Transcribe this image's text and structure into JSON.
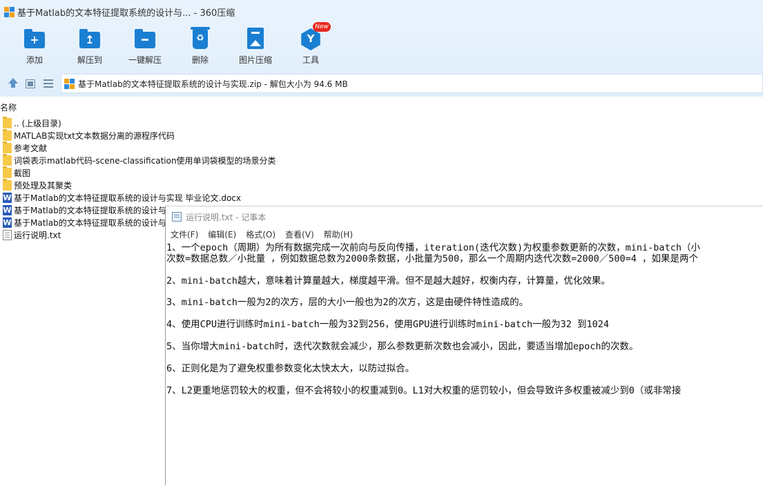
{
  "window": {
    "title": "基于Matlab的文本特征提取系统的设计与... - 360压缩"
  },
  "toolbar": {
    "items": [
      {
        "label": "添加",
        "icon": "add-folder-icon"
      },
      {
        "label": "解压到",
        "icon": "extract-to-icon"
      },
      {
        "label": "一键解压",
        "icon": "one-click-extract-icon"
      },
      {
        "label": "删除",
        "icon": "delete-icon"
      },
      {
        "label": "图片压缩",
        "icon": "image-compress-icon"
      },
      {
        "label": "工具",
        "icon": "tools-icon",
        "badge": "New"
      }
    ]
  },
  "address": {
    "text": "基于Matlab的文本特征提取系统的设计与实现.zip - 解包大小为 94.6 MB"
  },
  "file_list": {
    "header": "名称",
    "items": [
      {
        "name": ".. (上级目录)",
        "type": "folder"
      },
      {
        "name": "MATLAB实现txt文本数据分离的源程序代码",
        "type": "folder"
      },
      {
        "name": "参考文献",
        "type": "folder"
      },
      {
        "name": "词袋表示matlab代码-scene-classification使用单词袋模型的场景分类",
        "type": "folder"
      },
      {
        "name": "截图",
        "type": "folder"
      },
      {
        "name": "预处理及其聚类",
        "type": "folder"
      },
      {
        "name": "基于Matlab的文本特征提取系统的设计与实现 毕业论文.docx",
        "type": "word"
      },
      {
        "name": "基于Matlab的文本特征提取系统的设计与",
        "type": "word"
      },
      {
        "name": "基于Matlab的文本特征提取系统的设计与",
        "type": "word"
      },
      {
        "name": "运行说明.txt",
        "type": "txt"
      }
    ]
  },
  "notepad": {
    "title": "运行说明.txt - 记事本",
    "menu": [
      "文件(F)",
      "编辑(E)",
      "格式(O)",
      "查看(V)",
      "帮助(H)"
    ],
    "lines": [
      "1、一个epoch（周期）为所有数据完成一次前向与反向传播，iteration(迭代次数)为权重参数更新的次数，mini-batch（小",
      "次数=数据总数／小批量 ，例如数据总数为2000条数据，小批量为500，那么一个周期内迭代次数=2000／500=4 ，如果是两个",
      "2、mini-batch越大，意味着计算量越大，梯度越平滑。但不是越大越好，权衡内存，计算量，优化效果。",
      "3、mini-batch一般为2的次方，层的大小一般也为2的次方，这是由硬件特性造成的。",
      "4、使用CPU进行训练时mini-batch一般为32到256，使用GPU进行训练时mini-batch一般为32 到1024",
      "5、当你增大mini-batch时，迭代次数就会减少，那么参数更新次数也会减小，因此，要适当增加epoch的次数。",
      "6、正则化是为了避免权重参数变化太快太大，以防过拟合。",
      "7、L2更重地惩罚较大的权重，但不会将较小的权重减到0。L1对大权重的惩罚较小，但会导致许多权重被减少到0（或非常接"
    ]
  }
}
